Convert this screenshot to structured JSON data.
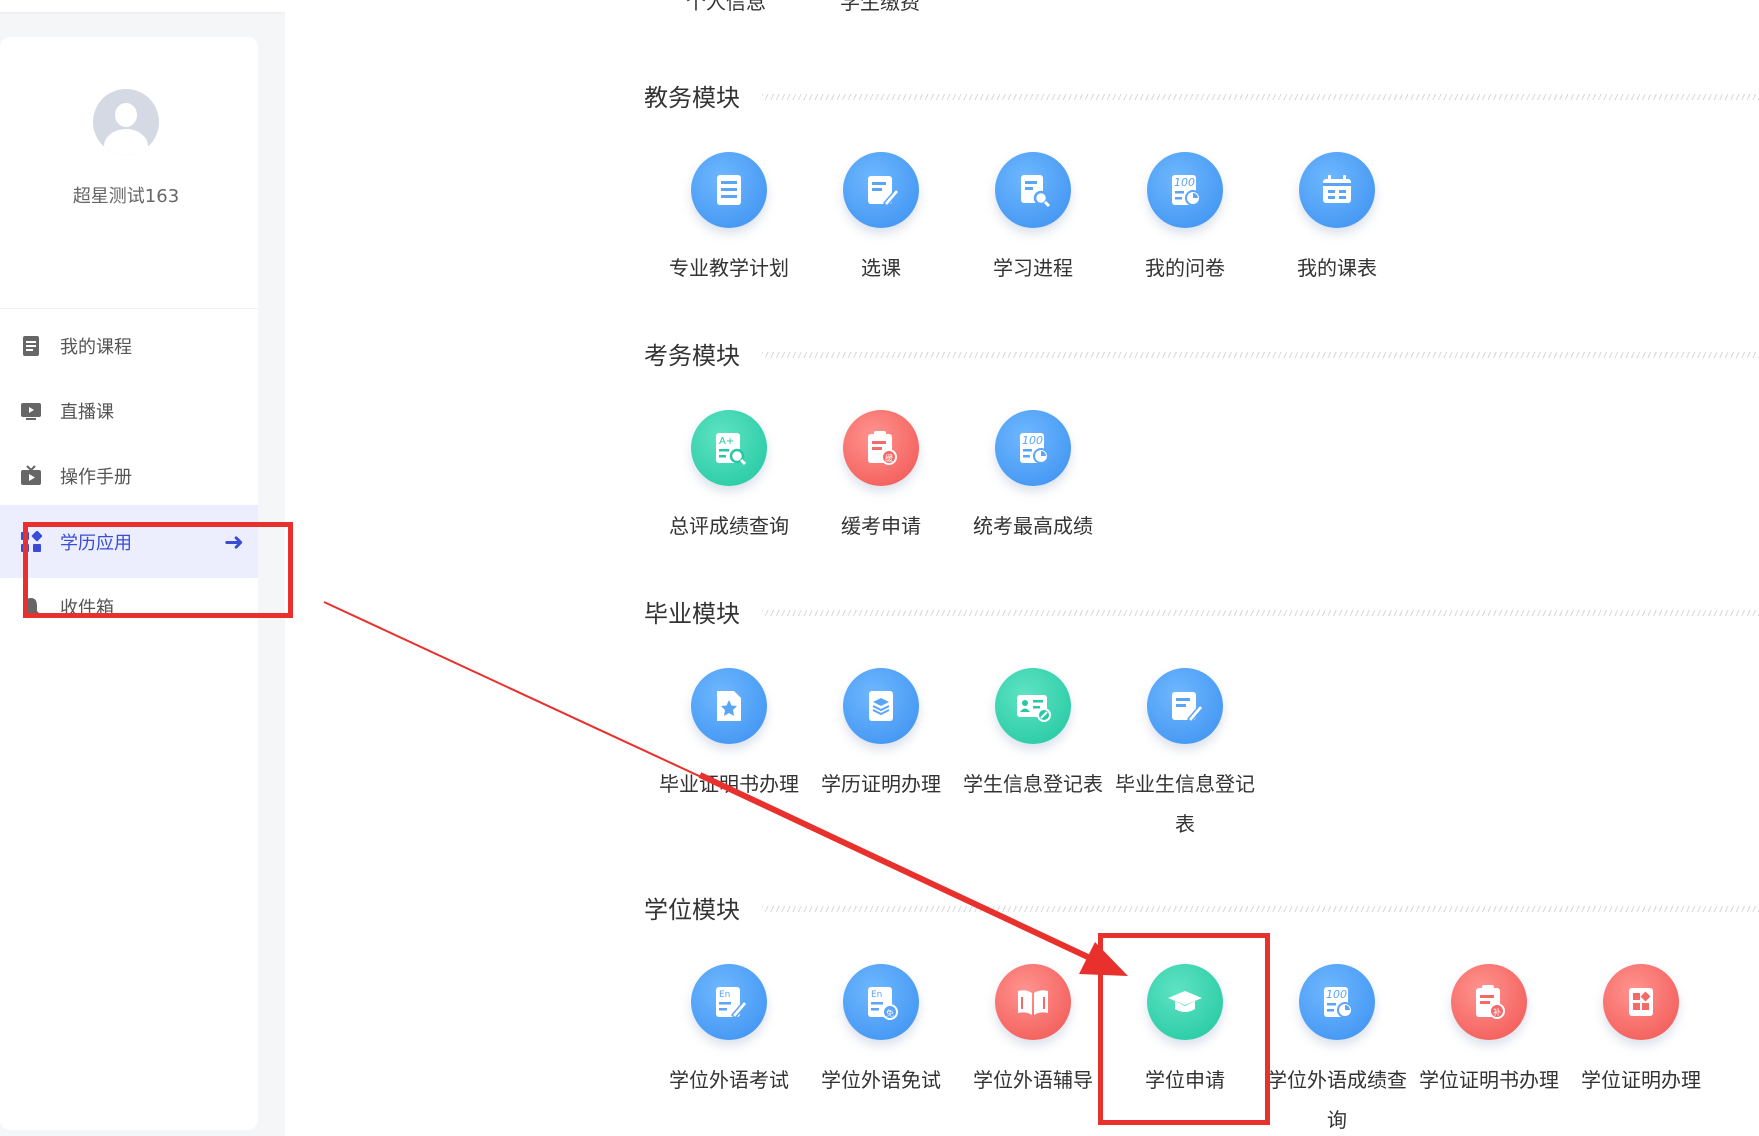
{
  "sidebar": {
    "username": "超星测试163",
    "items": [
      {
        "label": "我的课程",
        "icon": "course-icon"
      },
      {
        "label": "直播课",
        "icon": "live-icon"
      },
      {
        "label": "操作手册",
        "icon": "manual-icon"
      },
      {
        "label": "学历应用",
        "icon": "apps-icon",
        "active": true
      },
      {
        "label": "收件箱",
        "icon": "bell-icon"
      }
    ]
  },
  "top_partial": [
    "个人信息",
    "学生缴费"
  ],
  "sections": [
    {
      "title": "教务模块",
      "apps": [
        {
          "label": "专业教学计划",
          "color": "blue",
          "icon": "list-doc-icon"
        },
        {
          "label": "选课",
          "color": "blue",
          "icon": "edit-doc-icon"
        },
        {
          "label": "学习进程",
          "color": "blue",
          "icon": "search-doc-icon"
        },
        {
          "label": "我的问卷",
          "color": "blue",
          "icon": "score-100-icon"
        },
        {
          "label": "我的课表",
          "color": "blue",
          "icon": "calendar-icon"
        }
      ]
    },
    {
      "title": "考务模块",
      "apps": [
        {
          "label": "总评成绩查询",
          "color": "green",
          "icon": "grade-search-icon"
        },
        {
          "label": "缓考申请",
          "color": "red",
          "icon": "deferred-exam-icon"
        },
        {
          "label": "统考最高成绩",
          "color": "blue",
          "icon": "score-100-icon"
        }
      ]
    },
    {
      "title": "毕业模块",
      "apps": [
        {
          "label": "毕业证明书办理",
          "color": "blue",
          "icon": "certificate-star-icon"
        },
        {
          "label": "学历证明办理",
          "color": "blue",
          "icon": "layers-book-icon"
        },
        {
          "label": "学生信息登记表",
          "color": "green",
          "icon": "id-card-icon"
        },
        {
          "label": "毕业生信息登记表",
          "color": "blue",
          "icon": "edit-doc-icon"
        }
      ]
    },
    {
      "title": "学位模块",
      "apps": [
        {
          "label": "学位外语考试",
          "color": "blue",
          "icon": "en-edit-icon"
        },
        {
          "label": "学位外语免试",
          "color": "blue",
          "icon": "en-exempt-icon"
        },
        {
          "label": "学位外语辅导",
          "color": "red",
          "icon": "book-open-icon"
        },
        {
          "label": "学位申请",
          "color": "green",
          "icon": "graduation-cap-icon"
        },
        {
          "label": "学位外语成绩查询",
          "color": "blue",
          "icon": "score-100-icon"
        },
        {
          "label": "学位证明书办理",
          "color": "red",
          "icon": "supplement-doc-icon"
        },
        {
          "label": "学位证明办理",
          "color": "red",
          "icon": "grid-doc-icon"
        }
      ]
    }
  ],
  "annotation_color": "#e8302c"
}
